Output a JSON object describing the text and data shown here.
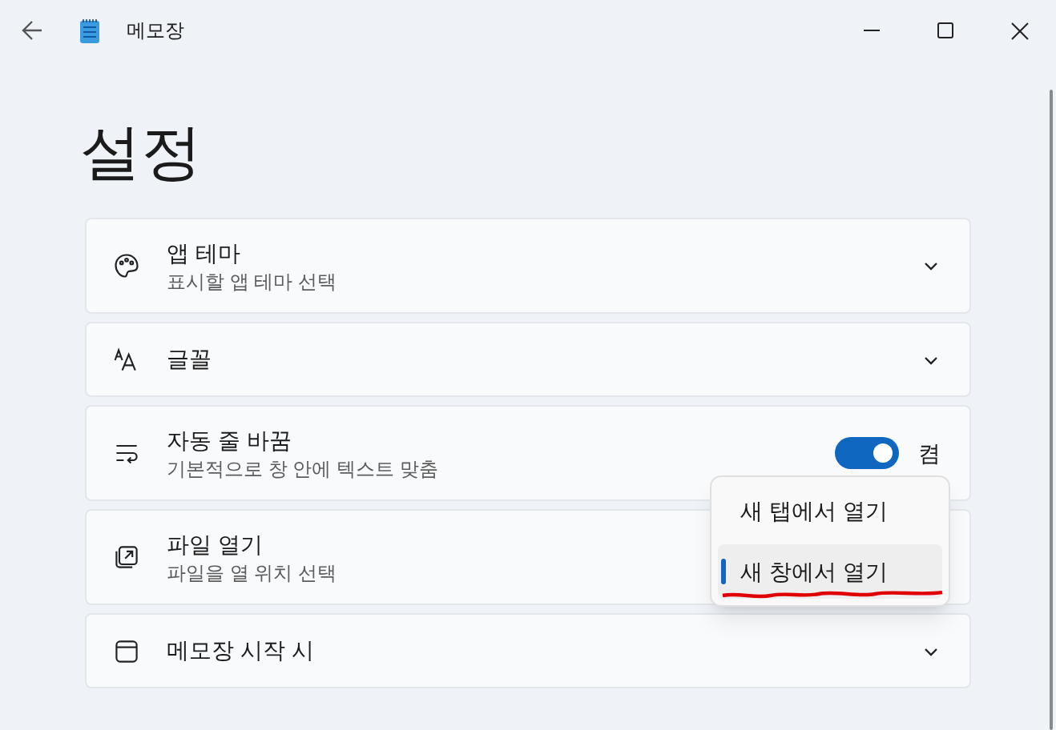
{
  "window": {
    "title": "메모장"
  },
  "heading": "설정",
  "settings": [
    {
      "kind": "expander",
      "title": "앱 테마",
      "subtitle": "표시할 앱 테마 선택"
    },
    {
      "kind": "expander",
      "title": "글꼴"
    },
    {
      "kind": "toggle",
      "title": "자동 줄 바꿈",
      "subtitle": "기본적으로 창 안에 텍스트 맞춤",
      "on": true,
      "state_label": "켬"
    },
    {
      "kind": "select",
      "title": "파일 열기",
      "subtitle": "파일을 열 위치 선택"
    },
    {
      "kind": "expander",
      "title": "메모장 시작 시"
    }
  ],
  "dropdown": {
    "options": [
      {
        "label": "새 탭에서 열기",
        "selected": false
      },
      {
        "label": "새 창에서 열기",
        "selected": true
      }
    ]
  }
}
